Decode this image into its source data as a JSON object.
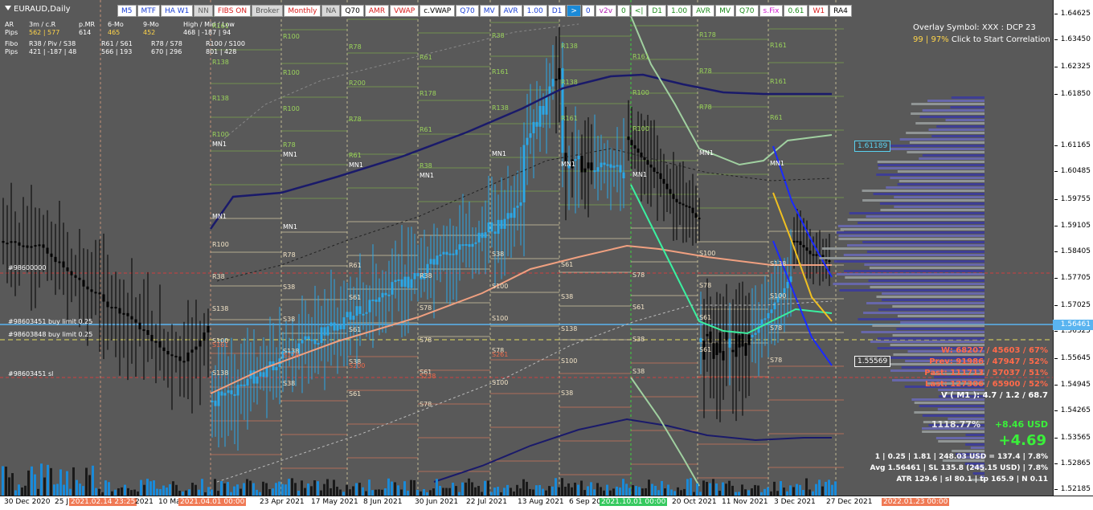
{
  "symbol": {
    "label": "EURAUD,Daily"
  },
  "toolbar": [
    {
      "label": "M5",
      "bg": "#ffffff",
      "fg": "#1a3fd6"
    },
    {
      "label": "MTF",
      "bg": "#ffffff",
      "fg": "#1a3fd6"
    },
    {
      "label": "HA W1",
      "bg": "#ffffff",
      "fg": "#1a3fd6"
    },
    {
      "label": "NN",
      "bg": "#d8d8d8",
      "fg": "#666666"
    },
    {
      "label": "FIBS ON",
      "bg": "#ffffff",
      "fg": "#d81b1b"
    },
    {
      "label": "Broker",
      "bg": "#d8d8d8",
      "fg": "#555555"
    },
    {
      "label": "Monthly",
      "bg": "#ffffff",
      "fg": "#d81b1b"
    },
    {
      "label": "NA",
      "bg": "#d8d8d8",
      "fg": "#555555"
    },
    {
      "label": "Q70",
      "bg": "#ffffff",
      "fg": "#000000"
    },
    {
      "label": "AMR",
      "bg": "#ffffff",
      "fg": "#d81b1b"
    },
    {
      "label": "VWAP",
      "bg": "#ffffff",
      "fg": "#d81b1b"
    },
    {
      "label": "c.VWAP",
      "bg": "#ffffff",
      "fg": "#000000"
    },
    {
      "label": "Q70",
      "bg": "#ffffff",
      "fg": "#1a3fd6"
    },
    {
      "label": "MV",
      "bg": "#ffffff",
      "fg": "#1a3fd6"
    },
    {
      "label": "AVR",
      "bg": "#ffffff",
      "fg": "#1a3fd6"
    },
    {
      "label": "1.00",
      "bg": "#ffffff",
      "fg": "#1a3fd6"
    },
    {
      "label": "D1",
      "bg": "#ffffff",
      "fg": "#1a3fd6"
    },
    {
      "label": ">",
      "bg": "#1a8ad8",
      "fg": "#ffffff"
    },
    {
      "label": "0",
      "bg": "#ffffff",
      "fg": "#1a3fd6"
    },
    {
      "label": "v2v",
      "bg": "#ffffff",
      "fg": "#b01ab0"
    },
    {
      "label": "0",
      "bg": "#ffffff",
      "fg": "#1a8a1a"
    },
    {
      "label": "<|",
      "bg": "#ffffff",
      "fg": "#1a8a1a"
    },
    {
      "label": "D1",
      "bg": "#ffffff",
      "fg": "#1a8a1a"
    },
    {
      "label": "1.00",
      "bg": "#ffffff",
      "fg": "#1a8a1a"
    },
    {
      "label": "AVR",
      "bg": "#ffffff",
      "fg": "#1a8a1a"
    },
    {
      "label": "MV",
      "bg": "#ffffff",
      "fg": "#1a8a1a"
    },
    {
      "label": "Q70",
      "bg": "#ffffff",
      "fg": "#1a8a1a"
    },
    {
      "label": "s.Fix",
      "bg": "#ffffff",
      "fg": "#d01ad0"
    },
    {
      "label": "0.61",
      "bg": "#ffffff",
      "fg": "#1a8a1a"
    },
    {
      "label": "W1",
      "bg": "#ffffff",
      "fg": "#d81b1b"
    },
    {
      "label": "RA4",
      "bg": "#ffffff",
      "fg": "#000000"
    }
  ],
  "stats": {
    "r1": [
      "AR",
      "3m / c.R",
      "p.MR",
      "6-Mo",
      "9-Mo",
      "High / Mid / Low"
    ],
    "r2": [
      "Pips",
      "562 | 577",
      "614",
      "465",
      "452",
      "468 | -187 | 94"
    ],
    "r3": [
      "Fibo",
      "R38 / Piv / S38",
      "R61 / S61",
      "R78 / S78",
      "R100 / S100"
    ],
    "r4": [
      "Pips",
      "421 | -187 | 48",
      "566 | 193",
      "670 | 296",
      "801 | 428"
    ]
  },
  "overlay": {
    "line1": "Overlay Symbol: XXX : DCP 23",
    "line2_pct": "99 | 97%",
    "line2_text": "Click to Start Correlation"
  },
  "right_stats": [
    {
      "text": "W: 68207 / 45603 / 67%",
      "color": "#ff6a4a"
    },
    {
      "text": "Prev: 91986 / 47947 / 52%",
      "color": "#ff6a4a"
    },
    {
      "text": "Past: 111713 / 57037 / 51%",
      "color": "#ff6a4a"
    },
    {
      "text": "Last: 127306 / 65900 / 52%",
      "color": "#ff6a4a"
    },
    {
      "text": "V ( M1 ): 4.7 / 1.2 / 68.7",
      "color": "#ffffff"
    }
  ],
  "profit": {
    "pct": "1118.77%",
    "usd": "+8.46 USD",
    "big": "+4.69"
  },
  "bottom_lines": [
    "1 | 0.25 | 1.81 | 248.03 USD = 137.4 | 7.8%",
    "Avg 1.56461 | SL 135.8 (245.15 USD) | 7.8%",
    "ATR 129.6 | sl 80.1 | tp 165.9 | N 0.11"
  ],
  "orders": {
    "o1": "#98600000",
    "o2": "#98603451 buy limit 0.25",
    "o3": "#98603848 buy limit 0.25",
    "o4": "#98603451 sl"
  },
  "price_tags": {
    "upper": {
      "text": "1.61189",
      "color": "#5ad2f0"
    },
    "lower": {
      "text": "1.55569",
      "color": "#ffffff"
    },
    "current": {
      "text": "1.56461",
      "color": "#5ab4f0"
    }
  },
  "price_axis": [
    "1.64625",
    "1.63450",
    "1.62325",
    "1.61850",
    "1.61165",
    "1.60485",
    "1.59755",
    "1.59105",
    "1.58405",
    "1.57705",
    "1.57025",
    "1.56325",
    "1.55645",
    "1.54945",
    "1.54265",
    "1.53565",
    "1.52865",
    "1.52185"
  ],
  "time_axis": [
    {
      "text": "30 Dec 2020",
      "style": ""
    },
    {
      "text": "25 J",
      "style": ""
    },
    {
      "text": "2021.02.14 23:25",
      "style": "hl"
    },
    {
      "text": "2021",
      "style": ""
    },
    {
      "text": "10 Ma",
      "style": ""
    },
    {
      "text": "2021.04.01 00:00",
      "style": "hl"
    },
    {
      "text": "23 Apr 2021",
      "style": ""
    },
    {
      "text": "17 May 2021",
      "style": ""
    },
    {
      "text": "8 Jun 2021",
      "style": ""
    },
    {
      "text": "30 Jun 2021",
      "style": ""
    },
    {
      "text": "22 Jul 2021",
      "style": ""
    },
    {
      "text": "13 Aug 2021",
      "style": ""
    },
    {
      "text": "6 Sep 20",
      "style": ""
    },
    {
      "text": "2021.10.01 00:00",
      "style": "hl2"
    },
    {
      "text": "20 Oct 2021",
      "style": ""
    },
    {
      "text": "11 Nov 2021",
      "style": ""
    },
    {
      "text": "3 Dec 2021",
      "style": ""
    },
    {
      "text": "27 Dec 2021",
      "style": ""
    },
    {
      "text": "2022.01.23 00:00",
      "style": "hl"
    }
  ],
  "levels": {
    "g": [
      "R161",
      "R100",
      "R78",
      "R61",
      "R38",
      "R138",
      "R161",
      "R178",
      "R161",
      "R138",
      "R100",
      "R200",
      "R178",
      "R161",
      "R138",
      "R100",
      "R78",
      "R161",
      "R138",
      "R100",
      "R78",
      "R61",
      "R138",
      "R161",
      "R100",
      "R78",
      "R61",
      "R100",
      "R78",
      "R61",
      "R38"
    ],
    "w": [
      "R100",
      "R78",
      "R61",
      "R38",
      "S38",
      "S61",
      "S78",
      "S100",
      "S138",
      "R38",
      "S38",
      "S61",
      "S78",
      "S100",
      "S38",
      "S61",
      "S78",
      "S100",
      "S138",
      "S38",
      "S61",
      "S78",
      "S100",
      "S138",
      "S38",
      "S61",
      "S78",
      "S100",
      "S138",
      "S38",
      "S61",
      "S78",
      "S100",
      "S38",
      "S61",
      "S78",
      "S138",
      "S38",
      "S61",
      "S78",
      "S100",
      "S38"
    ],
    "r": [
      "S161",
      "S178",
      "S200",
      "S238",
      "S261"
    ],
    "mn": [
      "MN1",
      "MN1",
      "MN1",
      "MN1",
      "MN1",
      "MN1",
      "MN1",
      "MN1",
      "MN1",
      "MN1",
      "MN1"
    ]
  }
}
